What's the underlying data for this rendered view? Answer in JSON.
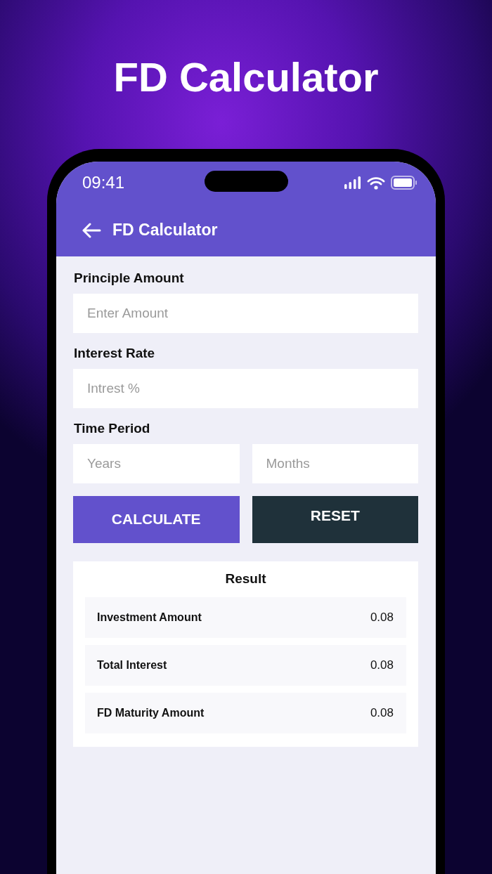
{
  "headline": "FD Calculator",
  "status_bar": {
    "time": "09:41"
  },
  "app_bar": {
    "title": "FD Calculator"
  },
  "form": {
    "fields": [
      {
        "label": "Principle Amount",
        "inputs": [
          {
            "placeholder": "Enter Amount"
          }
        ]
      },
      {
        "label": "Interest Rate",
        "inputs": [
          {
            "placeholder": "Intrest %"
          }
        ]
      },
      {
        "label": "Time Period",
        "inputs": [
          {
            "placeholder": "Years"
          },
          {
            "placeholder": "Months"
          }
        ]
      }
    ]
  },
  "buttons": [
    {
      "label": "CALCULATE",
      "kind": "primary"
    },
    {
      "label": "RESET",
      "kind": "dark"
    }
  ],
  "result": {
    "title": "Result",
    "rows": [
      {
        "label": "Investment Amount",
        "value": "0.08"
      },
      {
        "label": "Total Interest",
        "value": "0.08"
      },
      {
        "label": "FD Maturity Amount",
        "value": "0.08"
      }
    ]
  }
}
